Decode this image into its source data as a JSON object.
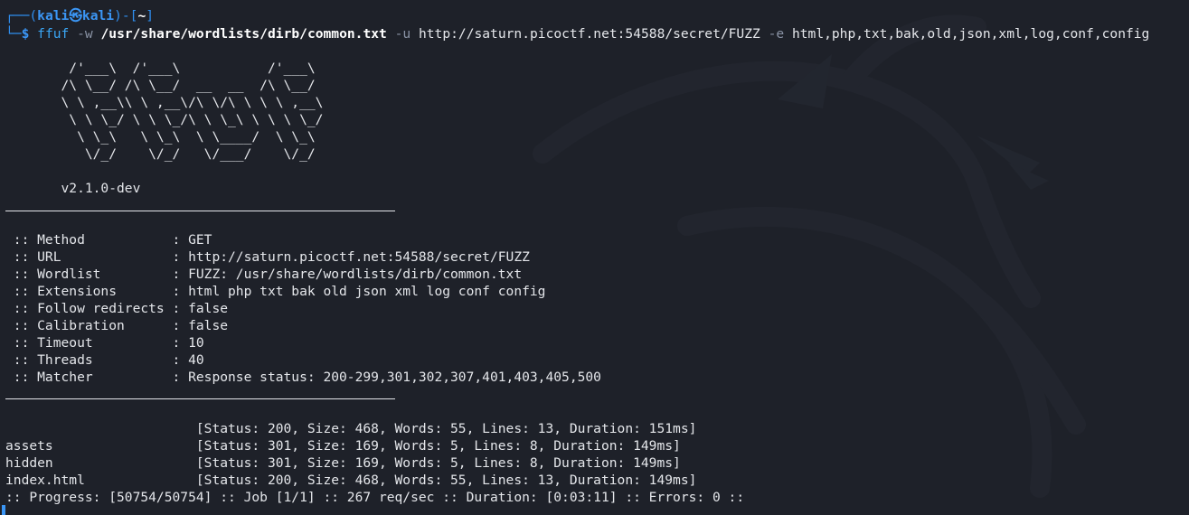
{
  "prompt": {
    "user": "kali",
    "host": "kali",
    "cwd": "~",
    "corner_top": "┌──(",
    "at_symbol": "㉿",
    "mid": ")-[",
    "end": "]",
    "corner_bottom": "└─",
    "dollar": "$"
  },
  "command": {
    "bin": "ffuf",
    "flag_w": "-w",
    "wordlist": "/usr/share/wordlists/dirb/common.txt",
    "flag_u": "-u",
    "url": "http://saturn.picoctf.net:54588/secret/FUZZ",
    "flag_e": "-e",
    "extensions": "html,php,txt,bak,old,json,xml,log,conf,config"
  },
  "banner": {
    "ascii": [
      "        /'___\\  /'___\\           /'___\\       ",
      "       /\\ \\__/ /\\ \\__/  __  __  /\\ \\__/       ",
      "       \\ \\ ,__\\\\ \\ ,__\\/\\ \\/\\ \\ \\ \\ ,__\\      ",
      "        \\ \\ \\_/ \\ \\ \\_/\\ \\ \\_\\ \\ \\ \\ \\_/      ",
      "         \\ \\_\\   \\ \\_\\  \\ \\____/  \\ \\_\\       ",
      "          \\/_/    \\/_/   \\/___/    \\/_/       "
    ],
    "version": "       v2.1.0-dev"
  },
  "config": [
    " :: Method           : GET",
    " :: URL              : http://saturn.picoctf.net:54588/secret/FUZZ",
    " :: Wordlist         : FUZZ: /usr/share/wordlists/dirb/common.txt",
    " :: Extensions       : html php txt bak old json xml log conf config",
    " :: Follow redirects : false",
    " :: Calibration      : false",
    " :: Timeout          : 10",
    " :: Threads          : 40",
    " :: Matcher          : Response status: 200-299,301,302,307,401,403,405,500"
  ],
  "results": [
    "                        [Status: 200, Size: 468, Words: 55, Lines: 13, Duration: 151ms]",
    "assets                  [Status: 301, Size: 169, Words: 5, Lines: 8, Duration: 149ms]",
    "hidden                  [Status: 301, Size: 169, Words: 5, Lines: 8, Duration: 149ms]",
    "index.html              [Status: 200, Size: 468, Words: 55, Lines: 13, Duration: 149ms]"
  ],
  "progress": ":: Progress: [50754/50754] :: Job [1/1] :: 267 req/sec :: Duration: [0:03:11] :: Errors: 0 ::"
}
